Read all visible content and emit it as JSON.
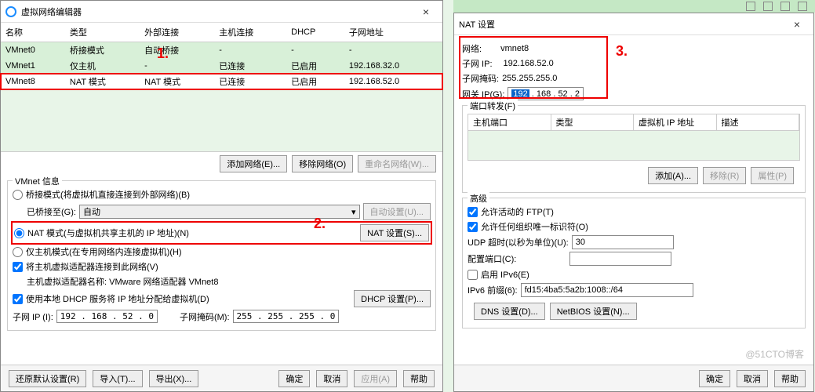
{
  "win1": {
    "title": "虚拟网络编辑器",
    "cols": {
      "name": "名称",
      "type": "类型",
      "ext": "外部连接",
      "host": "主机连接",
      "dhcp": "DHCP",
      "subnet": "子网地址"
    },
    "rows": [
      {
        "name": "VMnet0",
        "type": "桥接模式",
        "ext": "自动桥接",
        "host": "-",
        "dhcp": "-",
        "subnet": "-"
      },
      {
        "name": "VMnet1",
        "type": "仅主机",
        "ext": "-",
        "host": "已连接",
        "dhcp": "已启用",
        "subnet": "192.168.32.0"
      },
      {
        "name": "VMnet8",
        "type": "NAT 模式",
        "ext": "NAT 模式",
        "host": "已连接",
        "dhcp": "已启用",
        "subnet": "192.168.52.0"
      }
    ],
    "btns": {
      "add": "添加网络(E)...",
      "remove": "移除网络(O)",
      "rename": "重命名网络(W)..."
    },
    "info_label": "VMnet 信息",
    "radio_bridge": "桥接模式(将虚拟机直接连接到外部网络)(B)",
    "bridge_to": "已桥接至(G):",
    "bridge_auto": "自动",
    "bridge_autoset": "自动设置(U)...",
    "radio_nat": "NAT 模式(与虚拟机共享主机的 IP 地址)(N)",
    "nat_settings": "NAT 设置(S)...",
    "radio_host": "仅主机模式(在专用网络内连接虚拟机)(H)",
    "chk_hostadapter": "将主机虚拟适配器连接到此网络(V)",
    "hostadapter_name": "主机虚拟适配器名称: VMware 网络适配器 VMnet8",
    "chk_dhcp": "使用本地 DHCP 服务将 IP 地址分配给虚拟机(D)",
    "dhcp_settings": "DHCP 设置(P)...",
    "subnet_ip_label": "子网 IP (I):",
    "subnet_ip": "192 . 168 . 52 . 0",
    "subnet_mask_label": "子网掩码(M):",
    "subnet_mask": "255 . 255 . 255 . 0",
    "bottom": {
      "restore": "还原默认设置(R)",
      "import": "导入(T)...",
      "export": "导出(X)...",
      "ok": "确定",
      "cancel": "取消",
      "apply": "应用(A)",
      "help": "帮助"
    }
  },
  "win2": {
    "title": "NAT 设置",
    "net_label": "网络:",
    "net": "vmnet8",
    "subip_label": "子网 IP:",
    "subip": "192.168.52.0",
    "submask_label": "子网掩码:",
    "submask": "255.255.255.0",
    "gw_label": "网关 IP(G):",
    "gw_sel": "192",
    "gw_rest": " . 168 . 52 . 2",
    "portfwd_label": "端口转发(F)",
    "pf_cols": {
      "hostport": "主机端口",
      "type": "类型",
      "vmaddr": "虚拟机 IP 地址",
      "desc": "描述"
    },
    "pf_btns": {
      "add": "添加(A)...",
      "remove": "移除(R)",
      "props": "属性(P)"
    },
    "adv_label": "高级",
    "chk_ftp": "允许活动的 FTP(T)",
    "chk_anyorg": "允许任何组织唯一标识符(O)",
    "udp_label": "UDP 超时(以秒为单位)(U):",
    "udp_val": "30",
    "cfgport_label": "配置端口(C):",
    "cfgport_val": "",
    "chk_ipv6": "启用 IPv6(E)",
    "ipv6pfx_label": "IPv6 前缀(6):",
    "ipv6pfx": "fd15:4ba5:5a2b:1008::/64",
    "dns_btn": "DNS 设置(D)...",
    "netbios_btn": "NetBIOS 设置(N)...",
    "ok": "确定",
    "cancel": "取消",
    "help": "帮助"
  },
  "annot": {
    "a1": "1.",
    "a2": "2.",
    "a3": "3."
  },
  "watermark": "@51CTO博客"
}
